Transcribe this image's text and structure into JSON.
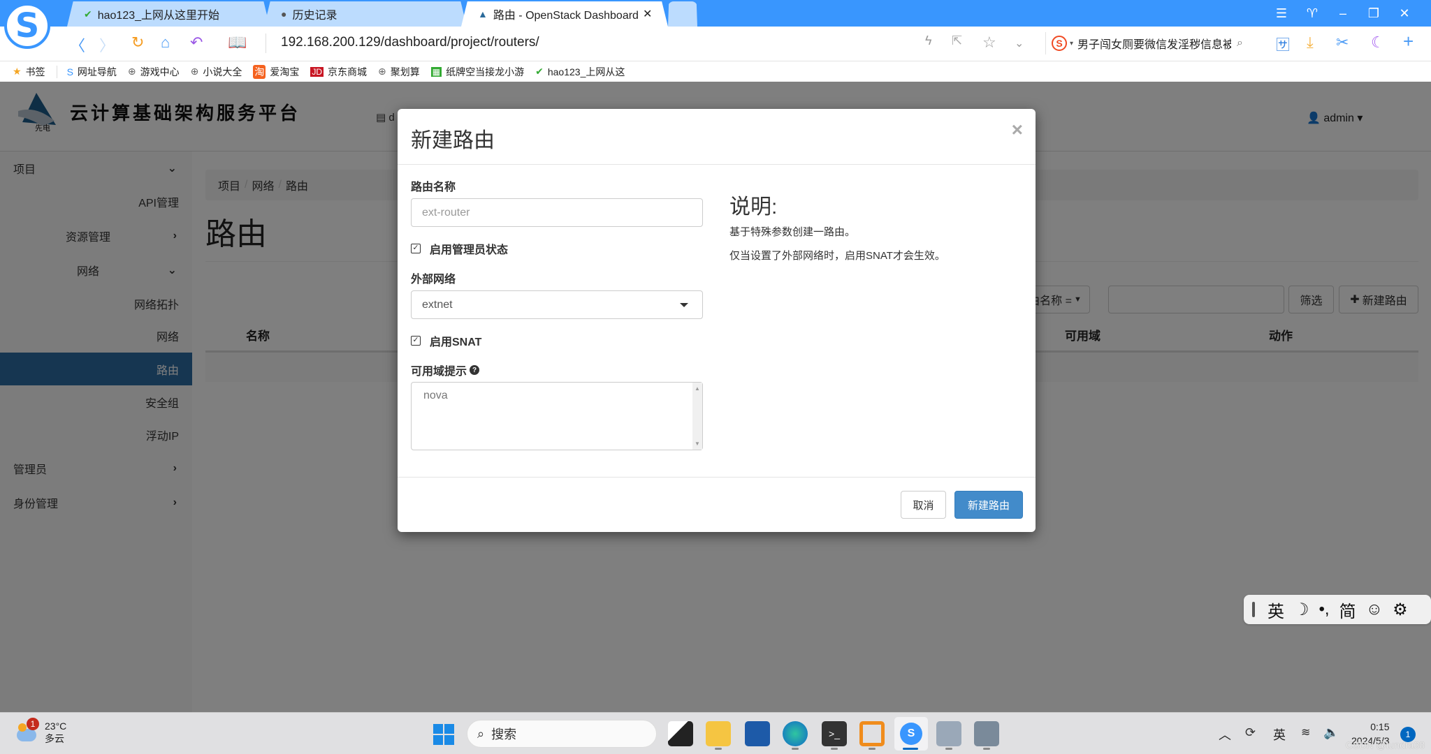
{
  "browser": {
    "tabs": [
      {
        "label": "hao123_上网从这里开始",
        "icon": "hao123-icon"
      },
      {
        "label": "历史记录",
        "icon": "history-icon"
      },
      {
        "label": "路由 - OpenStack Dashboard",
        "icon": "openstack-icon",
        "active": true
      }
    ],
    "url": "192.168.200.129/dashboard/project/routers/",
    "search_text": "男子闯女厕要微信发淫秽信息被拒",
    "bookmarks": [
      "书签",
      "网址导航",
      "游戏中心",
      "小说大全",
      "爱淘宝",
      "京东商城",
      "聚划算",
      "纸牌空当接龙小游",
      "hao123_上网从这"
    ]
  },
  "dashboard": {
    "brand": "云计算基础架构服务平台",
    "brand_logo_text": "先电",
    "project_label": "d",
    "user": "admin",
    "sidebar": [
      {
        "label": "项目",
        "chevron": "down",
        "level": 0
      },
      {
        "label": "API管理",
        "level": 2
      },
      {
        "label": "资源管理",
        "chevron": "right",
        "level": 1
      },
      {
        "label": "网络",
        "chevron": "down",
        "level": 1
      },
      {
        "label": "网络拓扑",
        "level": 2
      },
      {
        "label": "网络",
        "level": 2
      },
      {
        "label": "路由",
        "level": 2,
        "active": true
      },
      {
        "label": "安全组",
        "level": 2
      },
      {
        "label": "浮动IP",
        "level": 2
      },
      {
        "label": "管理员",
        "chevron": "right",
        "level": 0
      },
      {
        "label": "身份管理",
        "chevron": "right",
        "level": 0
      }
    ],
    "breadcrumb": [
      "项目",
      "网络",
      "路由"
    ],
    "page_title": "路由",
    "filter": {
      "field": "路由名称 =",
      "value": "",
      "filter_button": "筛选",
      "create_button": "新建路由"
    },
    "table_headers": [
      "名称",
      "可用域",
      "动作"
    ]
  },
  "modal": {
    "title": "新建路由",
    "close": "×",
    "name_label": "路由名称",
    "name_placeholder": "ext-router",
    "admin_state_label": "启用管理员状态",
    "admin_state_checked": true,
    "ext_net_label": "外部网络",
    "ext_net_value": "extnet",
    "snat_label": "启用SNAT",
    "snat_checked": true,
    "az_label": "可用域提示",
    "az_value": "nova",
    "desc_title": "说明:",
    "desc_lines": [
      "基于特殊参数创建一路由。",
      "仅当设置了外部网络时，启用SNAT才会生效。"
    ],
    "cancel": "取消",
    "submit": "新建路由"
  },
  "ime": {
    "lang": "英",
    "mode": "简"
  },
  "taskbar": {
    "weather_temp": "23°C",
    "weather_desc": "多云",
    "weather_badge": "1",
    "search_placeholder": "搜索",
    "tray_lang": "英",
    "time": "0:15",
    "date": "2024/5/3",
    "notifications": "1",
    "watermark": "CSDN @tundra38"
  }
}
